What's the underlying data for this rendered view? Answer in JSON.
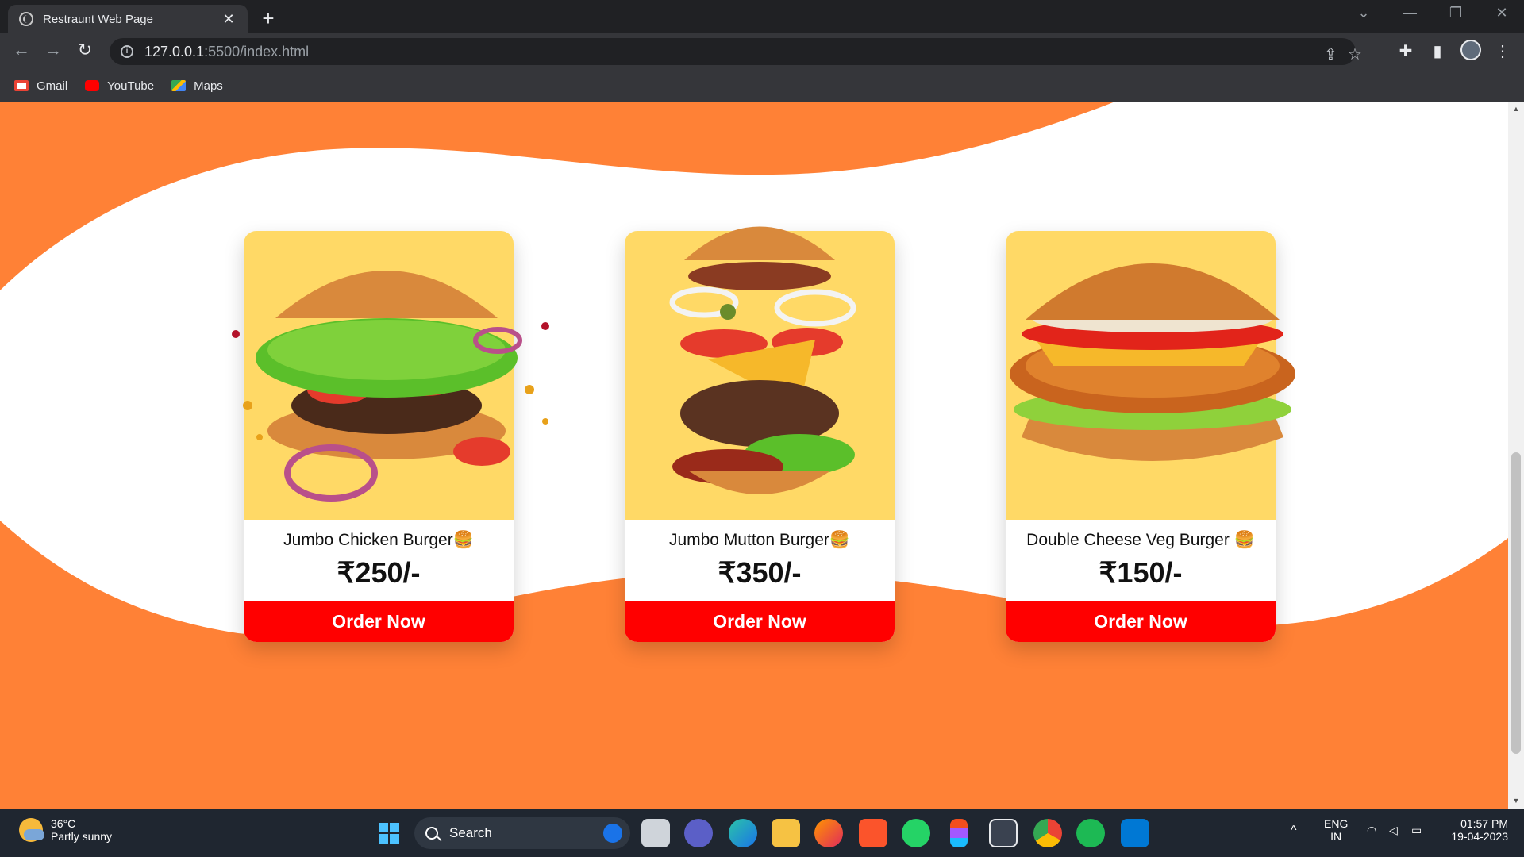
{
  "browser": {
    "tab_title": "Restraunt Web Page",
    "tab_close": "✕",
    "new_tab": "+",
    "url_host": "127.0.0.1",
    "url_path": ":5500/index.html",
    "bookmarks": [
      {
        "label": "Gmail",
        "icon": "gmail-icon",
        "color": "#ea4335"
      },
      {
        "label": "YouTube",
        "icon": "youtube-icon",
        "color": "#ff0000"
      },
      {
        "label": "Maps",
        "icon": "maps-icon",
        "color": "#34a853"
      }
    ]
  },
  "page": {
    "colors": {
      "accent": "#ff8136",
      "card_image_bg": "#ffd966",
      "order_button": "#ff0000"
    },
    "cards": [
      {
        "name": "Jumbo Chicken Burger",
        "emoji": "🍔",
        "price": "₹250/-",
        "button": "Order Now"
      },
      {
        "name": "Jumbo Mutton Burger",
        "emoji": "🍔",
        "price": "₹350/-",
        "button": "Order Now"
      },
      {
        "name": "Double Cheese Veg Burger ",
        "emoji": "🍔",
        "price": "₹150/-",
        "button": "Order Now"
      }
    ]
  },
  "taskbar": {
    "weather_temp": "36°C",
    "weather_desc": "Partly sunny",
    "search_label": "Search",
    "lang_top": "ENG",
    "lang_bottom": "IN",
    "time": "01:57 PM",
    "date": "19-04-2023"
  }
}
